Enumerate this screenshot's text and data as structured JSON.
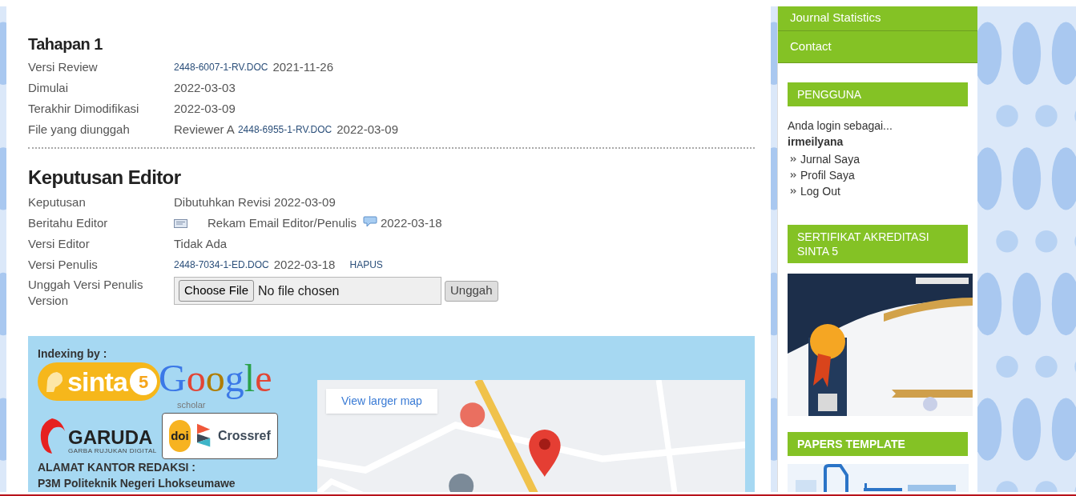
{
  "sidebar_menu": [
    {
      "label": "Journal Statistics"
    },
    {
      "label": "Contact"
    }
  ],
  "review_round": {
    "title": "Tahapan 1",
    "rows": [
      {
        "label": "Versi Review",
        "parts": [
          {
            "kind": "link",
            "text": "2448-6007-1-RV.DOC"
          },
          {
            "kind": "text",
            "text": "2021-11-26"
          }
        ]
      },
      {
        "label": "Dimulai",
        "parts": [
          {
            "kind": "text",
            "text": "2022-03-03"
          }
        ]
      },
      {
        "label": "Terakhir Dimodifikasi",
        "parts": [
          {
            "kind": "text",
            "text": "2022-03-09"
          }
        ]
      },
      {
        "label": "File yang diunggah",
        "parts": [
          {
            "kind": "text",
            "text": "Reviewer A"
          },
          {
            "kind": "link",
            "text": "2448-6955-1-RV.DOC"
          },
          {
            "kind": "text",
            "text": "2022-03-09"
          }
        ]
      }
    ]
  },
  "editor_decision": {
    "title": "Keputusan Editor",
    "rows": [
      {
        "label": "Keputusan",
        "parts": [
          {
            "kind": "text",
            "text": "Dibutuhkan Revisi 2022-03-09"
          }
        ]
      },
      {
        "label": "Beritahu Editor",
        "parts": [
          {
            "kind": "mail_icon"
          },
          {
            "kind": "text",
            "text": "Rekam Email Editor/Penulis"
          },
          {
            "kind": "comment_icon"
          },
          {
            "kind": "text",
            "text": "2022-03-18"
          }
        ]
      },
      {
        "label": "Versi Editor",
        "parts": [
          {
            "kind": "text",
            "text": "Tidak Ada"
          }
        ]
      },
      {
        "label": "Versi Penulis",
        "parts": [
          {
            "kind": "link",
            "text": "2448-7034-1-ED.DOC"
          },
          {
            "kind": "text",
            "text": "2022-03-18"
          },
          {
            "kind": "small_link",
            "text": "HAPUS"
          }
        ]
      },
      {
        "label": "Unggah Versi Penulis Version",
        "parts": [
          {
            "kind": "file",
            "button": "Choose File",
            "status": "No file chosen"
          },
          {
            "kind": "submit",
            "text": "Unggah"
          }
        ]
      }
    ]
  },
  "footer": {
    "title": "Indexing by :",
    "logos": [
      {
        "kind": "sinta",
        "name": "sinta",
        "badge": "5"
      },
      {
        "kind": "google",
        "name": "Google",
        "sub": "scholar"
      },
      {
        "kind": "garuda",
        "name": "GARUDA",
        "tagline": "GARBA RUJUKAN DIGITAL"
      },
      {
        "kind": "doi_crossref",
        "doi": "doi",
        "crossref": "Crossref"
      }
    ],
    "address": [
      "ALAMAT KANTOR REDAKSI :",
      "P3M Politeknik Negeri Lhokseumawe"
    ],
    "map": {
      "button": "View larger map"
    }
  },
  "user_block": {
    "title": "PENGGUNA",
    "intro": "Anda login sebagai...",
    "username": "irmeilyana",
    "links": [
      "Jurnal Saya",
      "Profil Saya",
      "Log Out"
    ]
  },
  "certificate_block": {
    "title": "SERTIFIKAT AKREDITASI SINTA 5"
  },
  "template_block": {
    "title": "PAPERS TEMPLATE"
  }
}
